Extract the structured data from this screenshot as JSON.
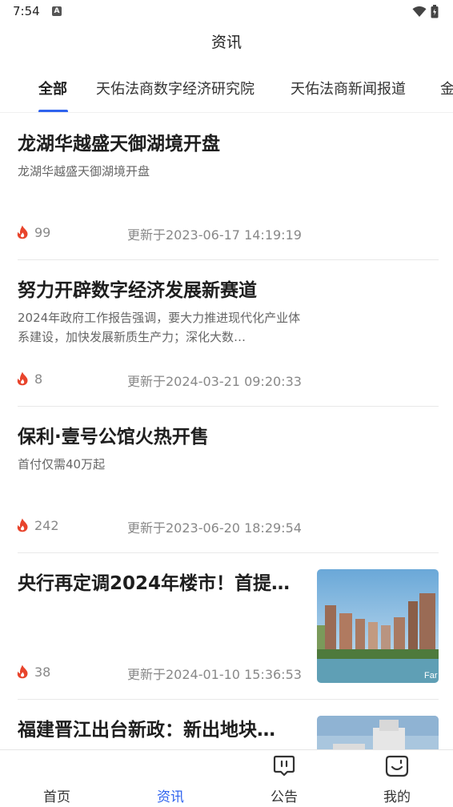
{
  "status_bar": {
    "time": "7:54",
    "notification_glyph": "A"
  },
  "header": {
    "title": "资讯"
  },
  "tabs": [
    {
      "label": "全部",
      "active": true
    },
    {
      "label": "天佑法商数字经济研究院"
    },
    {
      "label": "天佑法商新闻报道"
    },
    {
      "label": "金"
    }
  ],
  "articles": [
    {
      "title": "龙湖华越盛天御湖境开盘",
      "summary": "龙湖华越盛天御湖境开盘",
      "views": "99",
      "updated": "更新于2023-06-17 14:19:19"
    },
    {
      "title": "努力开辟数字经济发展新赛道",
      "summary": "2024年政府工作报告强调，要大力推进现代化产业体系建设，加快发展新质生产力；深化大数…",
      "views": "8",
      "updated": "更新于2024-03-21 09:20:33"
    },
    {
      "title": "保利·壹号公馆火热开售",
      "summary": "首付仅需40万起",
      "views": "242",
      "updated": "更新于2023-06-20 18:29:54"
    },
    {
      "title": "央行再定调2024年楼市！首提…",
      "summary": "",
      "views": "38",
      "updated": "更新于2024-01-10 15:36:53",
      "image_text": "Far"
    },
    {
      "title": "福建晋江出台新政：新出地块…",
      "summary": "",
      "views": "",
      "updated": ""
    }
  ],
  "bottom_nav": [
    {
      "label": "首页",
      "icon": "home-icon"
    },
    {
      "label": "资讯",
      "icon": "news-icon",
      "active": true
    },
    {
      "label": "公告",
      "icon": "announcement-icon"
    },
    {
      "label": "我的",
      "icon": "profile-icon"
    }
  ],
  "colors": {
    "accent": "#2f63ee",
    "fire": "#e8442c",
    "divider": "#e8e8e8"
  }
}
